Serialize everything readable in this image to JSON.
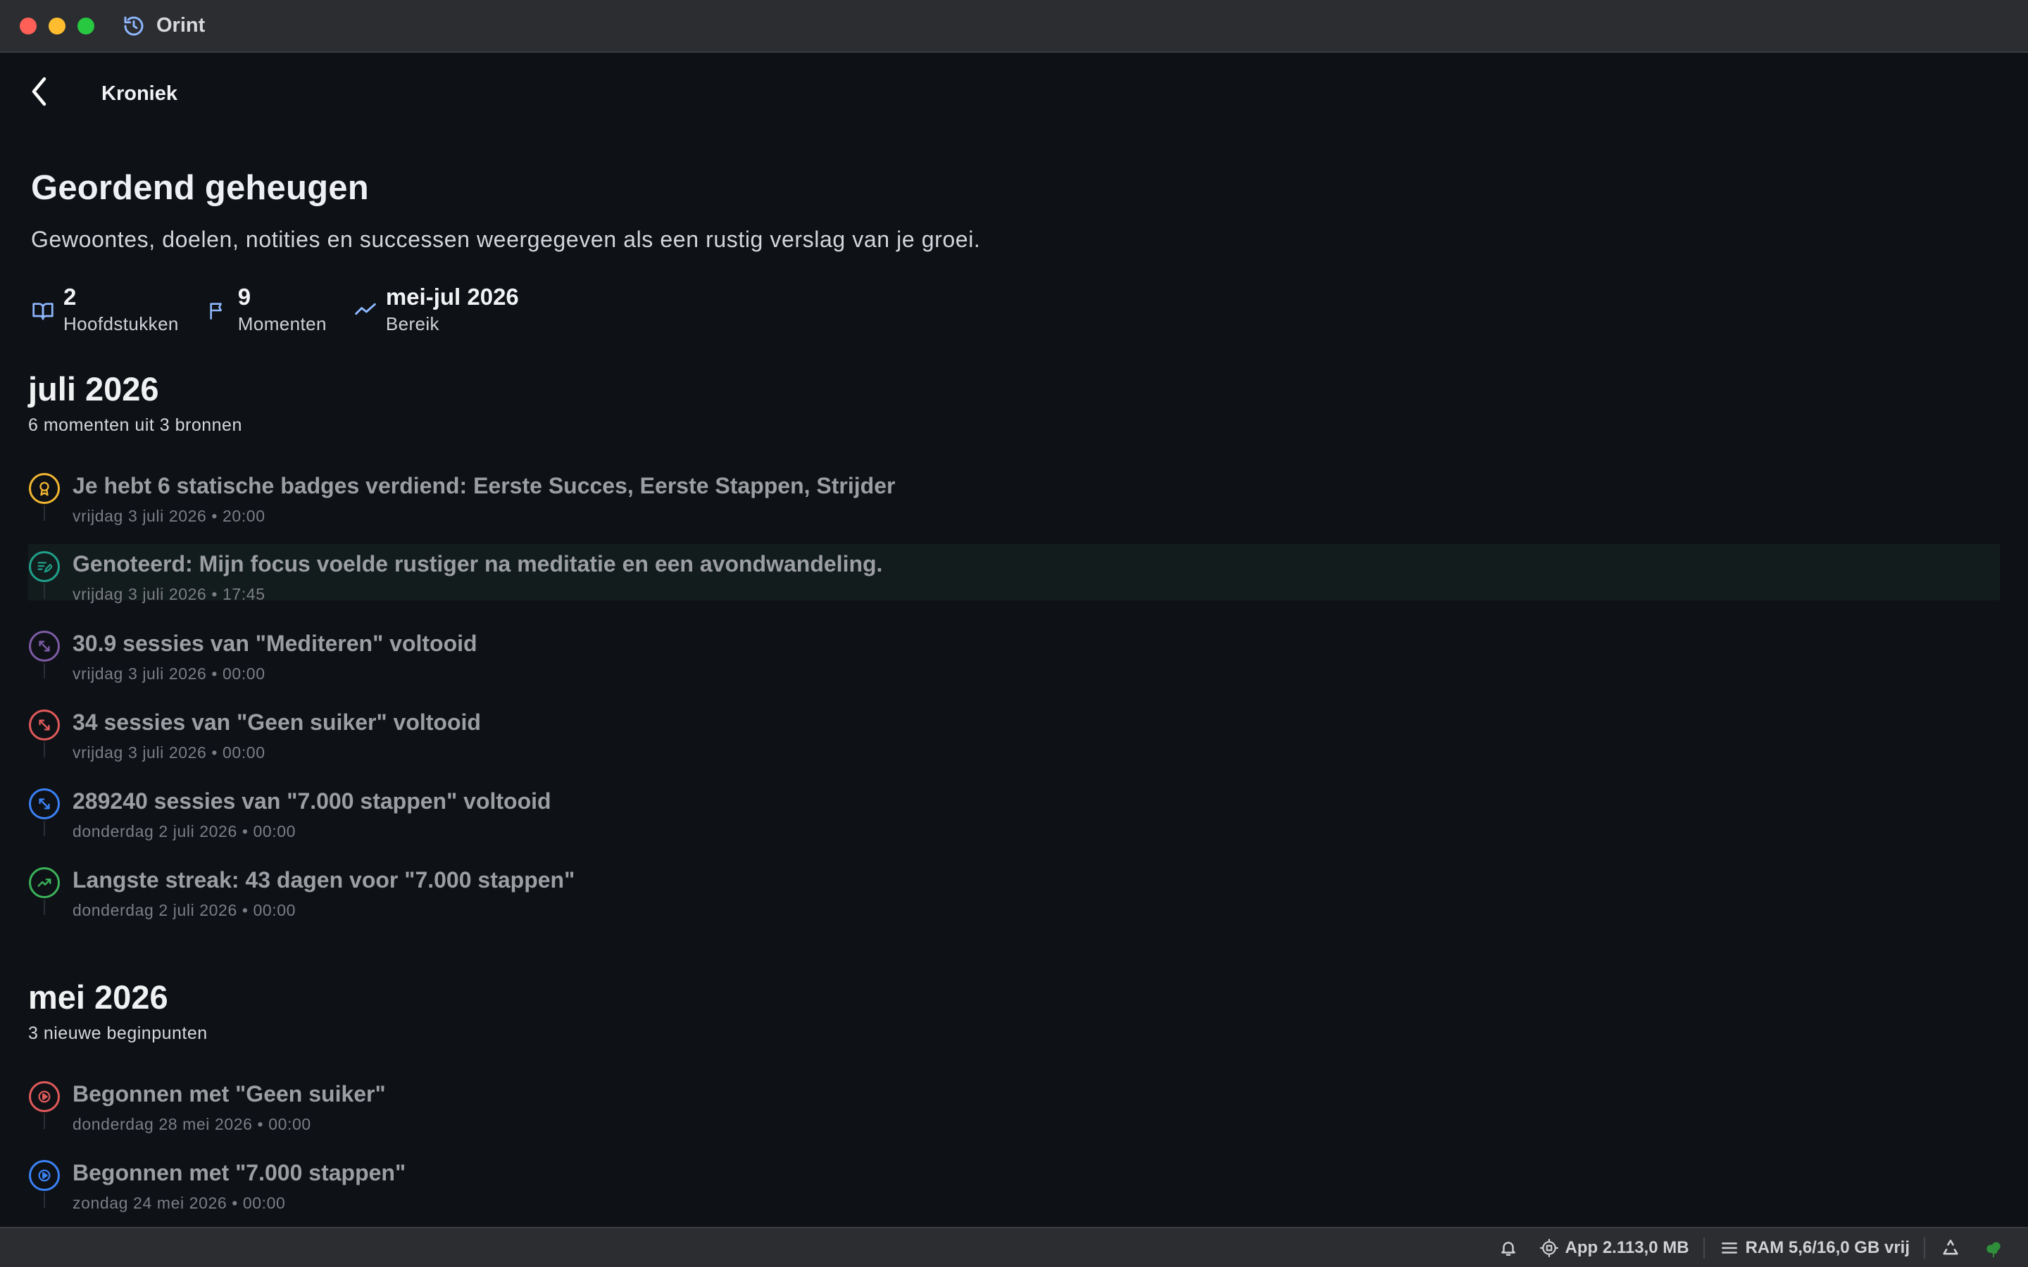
{
  "window": {
    "title": "Orint"
  },
  "nav": {
    "title": "Kroniek"
  },
  "header": {
    "title": "Geordend geheugen",
    "subtitle": "Gewoontes, doelen, notities en successen weergegeven als een rustig verslag van je groei."
  },
  "stats": [
    {
      "value": "2",
      "label": "Hoofdstukken",
      "icon": "book-open-icon"
    },
    {
      "value": "9",
      "label": "Momenten",
      "icon": "flag-icon"
    },
    {
      "value": "mei-jul 2026",
      "label": "Bereik",
      "icon": "trend-icon"
    }
  ],
  "sections": [
    {
      "title": "juli 2026",
      "subtitle": "6 momenten uit 3 bronnen",
      "entries": [
        {
          "title": "Je hebt 6 statische badges verdiend: Eerste Succes, Eerste Stappen, Strijder",
          "date": "vrijdag 3 juli 2026 • 20:00",
          "icon": "award-icon",
          "color": "#f2b631"
        },
        {
          "title": "Genoteerd: Mijn focus voelde rustiger na meditatie en een avondwandeling.",
          "date": "vrijdag 3 juli 2026 • 17:45",
          "icon": "note-edit-icon",
          "color": "#1fa08a"
        },
        {
          "title": "30.9 sessies van \"Mediteren\" voltooid",
          "date": "vrijdag 3 juli 2026 • 00:00",
          "icon": "expand-arrows-icon",
          "color": "#7d5ba6"
        },
        {
          "title": "34 sessies van \"Geen suiker\" voltooid",
          "date": "vrijdag 3 juli 2026 • 00:00",
          "icon": "expand-arrows-icon",
          "color": "#e05a5a"
        },
        {
          "title": "289240 sessies van \"7.000 stappen\" voltooid",
          "date": "donderdag 2 juli 2026 • 00:00",
          "icon": "expand-arrows-icon",
          "color": "#3b82f6"
        },
        {
          "title": "Langste streak: 43 dagen voor \"7.000 stappen\"",
          "date": "donderdag 2 juli 2026 • 00:00",
          "icon": "trending-up-icon",
          "color": "#3cb35a"
        }
      ]
    },
    {
      "title": "mei 2026",
      "subtitle": "3 nieuwe beginpunten",
      "entries": [
        {
          "title": "Begonnen met \"Geen suiker\"",
          "date": "donderdag 28 mei 2026 • 00:00",
          "icon": "play-circle-icon",
          "color": "#e05a5a"
        },
        {
          "title": "Begonnen met \"7.000 stappen\"",
          "date": "zondag 24 mei 2026 • 00:00",
          "icon": "play-circle-icon",
          "color": "#3b82f6"
        }
      ]
    }
  ],
  "statusbar": {
    "app_memory": "App 2.113,0 MB",
    "ram": "RAM 5,6/16,0 GB vrij"
  },
  "colors": {
    "accent": "#8fb8ff",
    "background": "#0e1116",
    "titlebar": "#2b2d31"
  }
}
